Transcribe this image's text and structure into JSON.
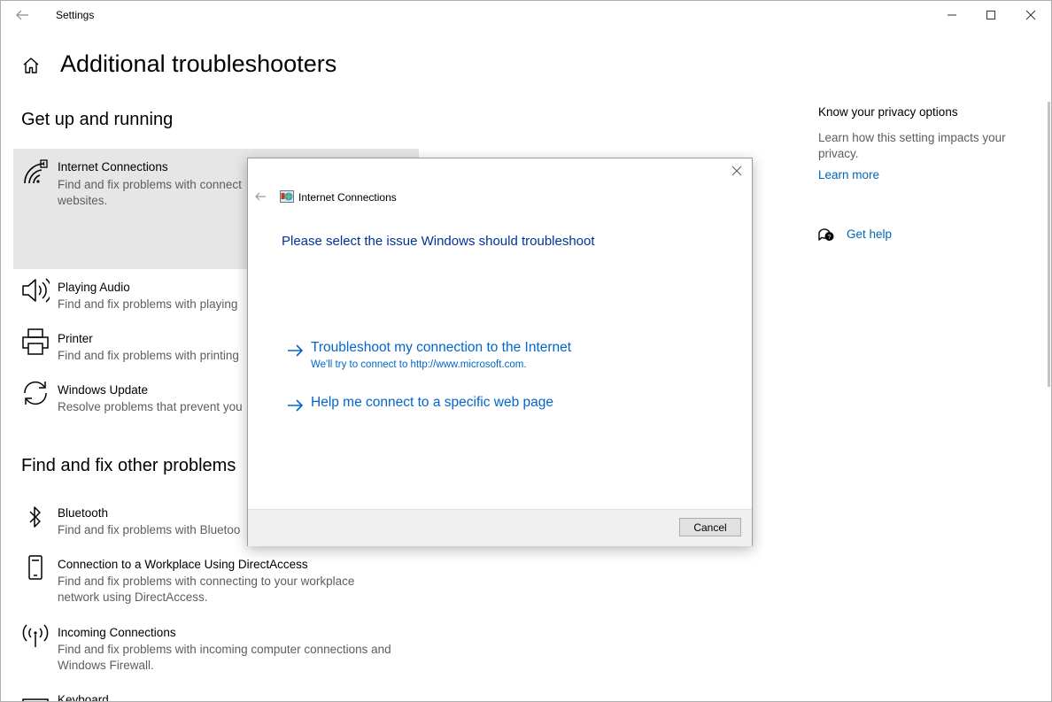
{
  "window": {
    "title": "Settings"
  },
  "page": {
    "title": "Additional troubleshooters"
  },
  "sections": {
    "running": {
      "heading": "Get up and running",
      "items": [
        {
          "name": "Internet Connections",
          "desc": "Find and fix problems with connect\nwebsites."
        },
        {
          "name": "Playing Audio",
          "desc": "Find and fix problems with playing"
        },
        {
          "name": "Printer",
          "desc": "Find and fix problems with printing"
        },
        {
          "name": "Windows Update",
          "desc": "Resolve problems that prevent you"
        }
      ]
    },
    "other": {
      "heading": "Find and fix other problems",
      "items": [
        {
          "name": "Bluetooth",
          "desc": "Find and fix problems with Bluetoo"
        },
        {
          "name": "Connection to a Workplace Using DirectAccess",
          "desc": "Find and fix problems with connecting to your workplace\nnetwork using DirectAccess."
        },
        {
          "name": "Incoming Connections",
          "desc": "Find and fix problems with incoming computer connections and\nWindows Firewall."
        },
        {
          "name": "Keyboard",
          "desc": ""
        }
      ]
    }
  },
  "right": {
    "privacy_title": "Know your privacy options",
    "privacy_desc": "Learn how this setting impacts your privacy.",
    "learn_more": "Learn more",
    "get_help": "Get help"
  },
  "dialog": {
    "title": "Internet Connections",
    "heading": "Please select the issue Windows should troubleshoot",
    "options": [
      {
        "main": "Troubleshoot my connection to the Internet",
        "sub": "We'll try to connect to http://www.microsoft.com."
      },
      {
        "main": "Help me connect to a specific web page",
        "sub": ""
      }
    ],
    "cancel": "Cancel"
  },
  "colors": {
    "link": "#0066b4",
    "dialog_heading": "#003399",
    "dialog_link": "#0066cc",
    "selected_bg": "#e6e6e6"
  }
}
